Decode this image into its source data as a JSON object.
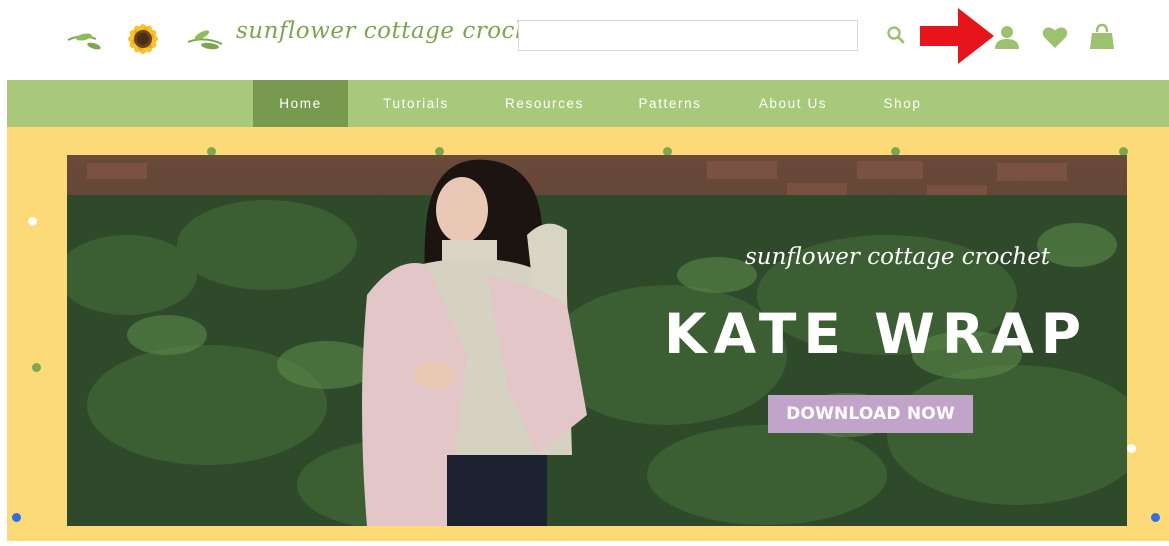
{
  "brand": {
    "name": "sunflower cottage crochet",
    "accent_color": "#7aa64f",
    "logo_icon": "sunflower-icon"
  },
  "search": {
    "value": "",
    "placeholder": ""
  },
  "header_icons": {
    "search": "search-icon",
    "account": "user-icon",
    "wishlist": "heart-icon",
    "cart": "shopping-bag-icon",
    "annotation": "red-arrow-icon"
  },
  "nav": {
    "background_color": "#a8c97a",
    "active_color": "#789a4f",
    "items": [
      {
        "label": "Home",
        "active": true
      },
      {
        "label": "Tutorials",
        "active": false
      },
      {
        "label": "Resources",
        "active": false
      },
      {
        "label": "Patterns",
        "active": false
      },
      {
        "label": "About Us",
        "active": false
      },
      {
        "label": "Shop",
        "active": false
      }
    ]
  },
  "hero": {
    "script_text": "sunflower cottage crochet",
    "title": "KATE WRAP",
    "cta_label": "DOWNLOAD NOW",
    "cta_color": "#c2a3c9",
    "frame_color": "#fdda78"
  }
}
